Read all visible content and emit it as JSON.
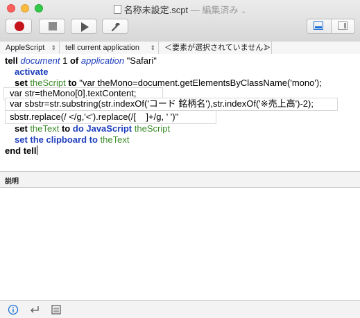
{
  "window": {
    "title": "名称未設定.scpt",
    "status": "— 編集済み"
  },
  "toolbar": {
    "record": "record-icon",
    "stop": "stop-icon",
    "run": "play-icon",
    "compile": "hammer-icon"
  },
  "navbar": {
    "language": "AppleScript",
    "target": "tell current application",
    "element": "＜要素が選択されていません＞"
  },
  "code": {
    "l1_tell": "tell",
    "l1_document": "document",
    "l1_one": " 1 ",
    "l1_of": "of",
    "l1_application": "application",
    "l1_safari": " \"Safari\"",
    "l2_activate": "activate",
    "l3_set": "set",
    "l3_var": "theScript",
    "l3_to": "to",
    "l3_str": " \"var theMono=document.getElementsByClassName('mono');",
    "l4": "var str=theMono[0].textContent;",
    "l5": "var sbstr=str.substring(str.indexOf('コード 銘柄名'),str.indexOf('※売上高')-2);",
    "l6": "sbstr.replace(/ </g,'<').replace(/[    ]+/g, ' ')\"",
    "l7_set": "set",
    "l7_var": "theText",
    "l7_to": "to",
    "l7_do": "do JavaScript",
    "l7_arg": "theScript",
    "l8_set": "set the clipboard to",
    "l8_var": "theText",
    "l9_end": "end tell"
  },
  "description_label": "説明",
  "colors": {
    "keyword_blue": "#1e3ebd",
    "variable_green": "#3c8b2a",
    "record_red": "#c5141b"
  }
}
